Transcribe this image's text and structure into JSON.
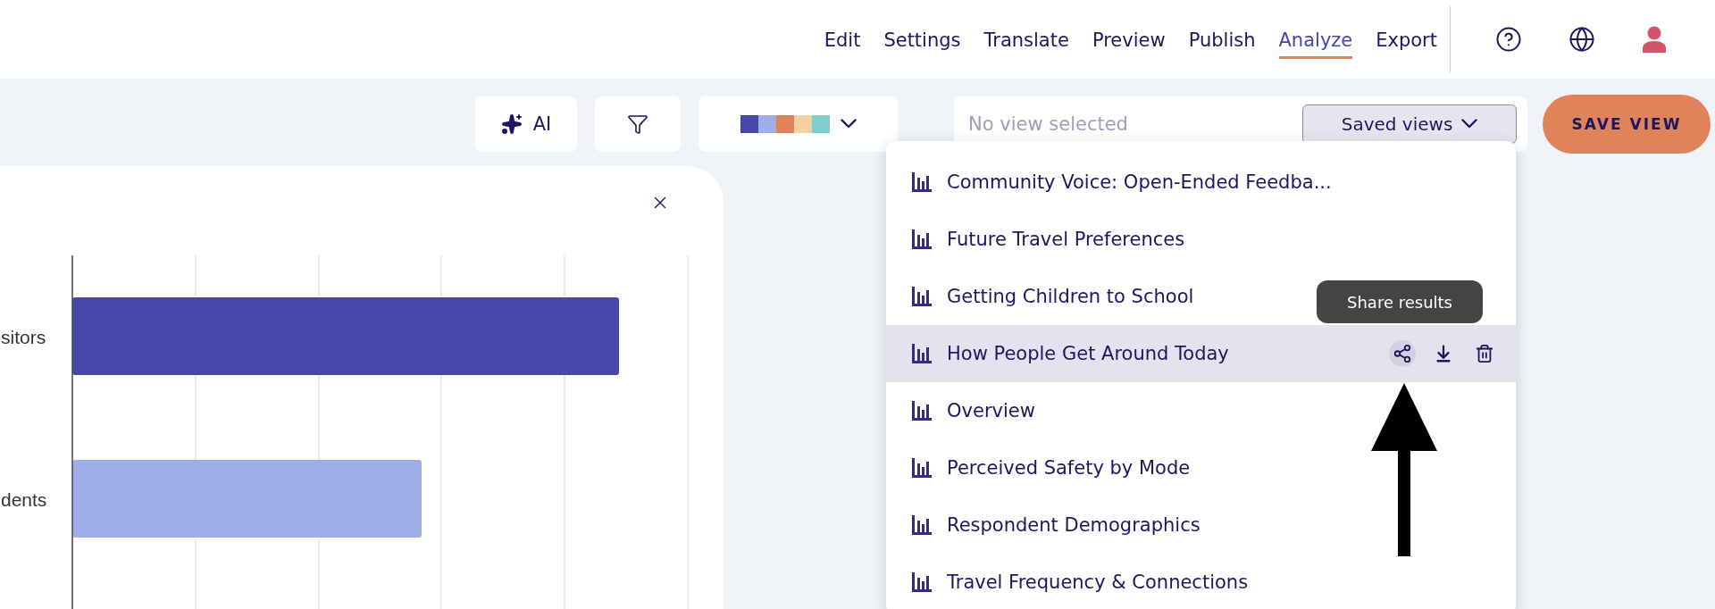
{
  "nav": {
    "items": [
      {
        "label": "Edit",
        "selected": false
      },
      {
        "label": "Settings",
        "selected": false
      },
      {
        "label": "Translate",
        "selected": false
      },
      {
        "label": "Preview",
        "selected": false
      },
      {
        "label": "Publish",
        "selected": false
      },
      {
        "label": "Analyze",
        "selected": true
      },
      {
        "label": "Export",
        "selected": false
      }
    ]
  },
  "toolbar": {
    "ai_button": "AI",
    "palette": [
      {
        "color": "#4547ab"
      },
      {
        "color": "#9daee8"
      },
      {
        "color": "#e0835a"
      },
      {
        "color": "#f4d0a0"
      },
      {
        "color": "#7ecfca"
      }
    ],
    "view_field": {
      "placeholder": "No view selected"
    },
    "saved_views_button": "Saved views",
    "save_button": "SAVE VIEW"
  },
  "chart_panel": {
    "categories": [
      "sitors",
      "dents"
    ]
  },
  "saved_views_menu": {
    "tooltip": "Share results",
    "items": [
      {
        "label": "Community Voice: Open-Ended Feedba...",
        "selected": false
      },
      {
        "label": "Future Travel Preferences",
        "selected": false
      },
      {
        "label": "Getting Children to School",
        "selected": false
      },
      {
        "label": "How People Get Around Today",
        "selected": true
      },
      {
        "label": "Overview",
        "selected": false
      },
      {
        "label": "Perceived Safety by Mode",
        "selected": false
      },
      {
        "label": "Respondent Demographics",
        "selected": false
      },
      {
        "label": "Travel Frequency & Connections",
        "selected": false
      }
    ]
  }
}
